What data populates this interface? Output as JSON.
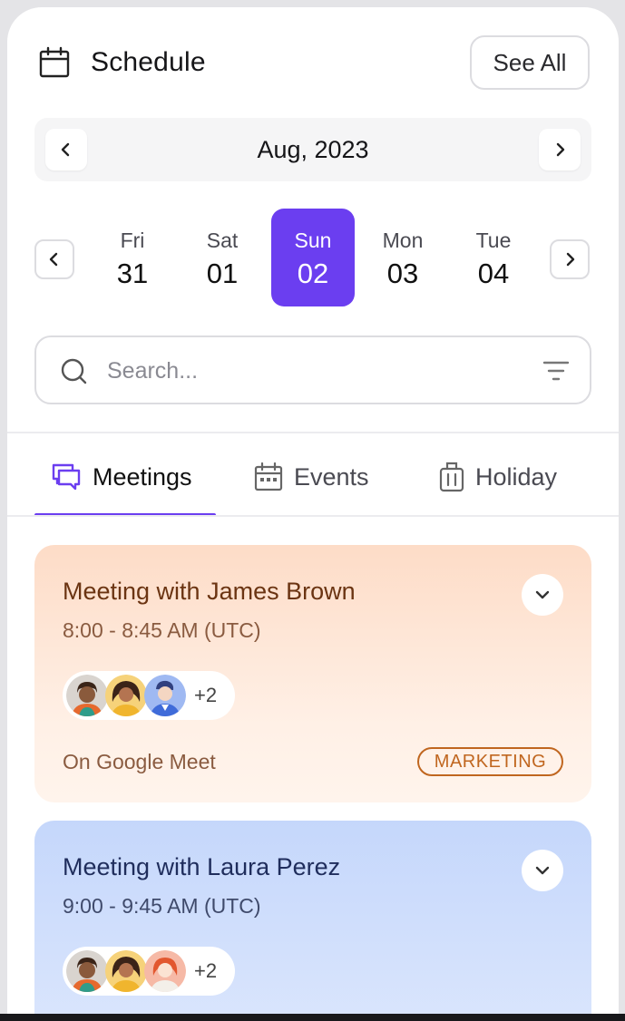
{
  "header": {
    "title": "Schedule",
    "see_all": "See All"
  },
  "month_nav": {
    "label": "Aug, 2023"
  },
  "days": [
    {
      "name": "Fri",
      "num": "31",
      "active": false
    },
    {
      "name": "Sat",
      "num": "01",
      "active": false
    },
    {
      "name": "Sun",
      "num": "02",
      "active": true
    },
    {
      "name": "Mon",
      "num": "03",
      "active": false
    },
    {
      "name": "Tue",
      "num": "04",
      "active": false
    }
  ],
  "search": {
    "placeholder": "Search..."
  },
  "tabs": [
    {
      "label": "Meetings",
      "icon": "chat-bubbles-icon",
      "active": true
    },
    {
      "label": "Events",
      "icon": "calendar-icon",
      "active": false
    },
    {
      "label": "Holiday",
      "icon": "luggage-icon",
      "active": false
    }
  ],
  "meetings": [
    {
      "title": "Meeting with James Brown",
      "time": "8:00 - 8:45 AM (UTC)",
      "more_attendees": "+2",
      "platform": "On Google Meet",
      "tag": "MARKETING",
      "theme": "orange"
    },
    {
      "title": "Meeting with Laura Perez",
      "time": "9:00 - 9:45 AM (UTC)",
      "more_attendees": "+2",
      "theme": "blue"
    }
  ],
  "colors": {
    "accent": "#6b3ef0",
    "orange_card": "#fddcc7",
    "blue_card": "#c5d7fb",
    "tag": "#c0661f"
  }
}
